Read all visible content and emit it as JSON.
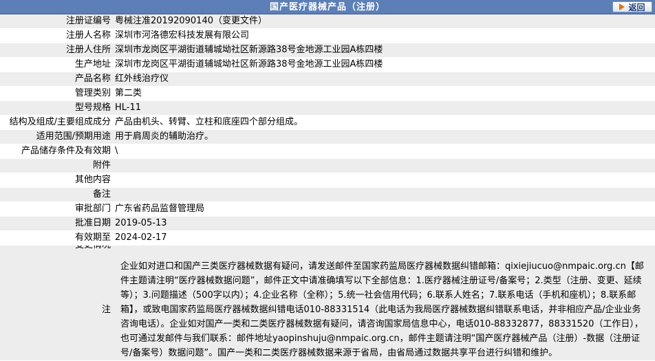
{
  "header": {
    "title": "国产医疗器械产品（注册）",
    "back_label": "返回",
    "colors": {
      "bar": "#5b7fb6",
      "row_alt": "#ededed"
    }
  },
  "fields": [
    {
      "label": "注册证编号",
      "value": "粤械注准20192090140（变更文件）"
    },
    {
      "label": "注册人名称",
      "value": "深圳市河洛德宏科技发展有限公司"
    },
    {
      "label": "注册人住所",
      "value": "深圳市龙岗区平湖街道辅城坳社区新源路38号金地源工业园A栋四楼"
    },
    {
      "label": "生产地址",
      "value": "深圳市龙岗区平湖街道辅城坳社区新源路38号金地源工业园A栋四楼"
    },
    {
      "label": "产品名称",
      "value": "红外线治疗仪"
    },
    {
      "label": "管理类别",
      "value": "第二类"
    },
    {
      "label": "型号规格",
      "value": "HL-11"
    },
    {
      "label": "结构及组成/主要组成成分",
      "value": "产品由机头、转臂、立柱和底座四个部分组成。"
    },
    {
      "label": "适用范围/预期用途",
      "value": "用于肩周炎的辅助治疗。"
    },
    {
      "label": "产品储存条件及有效期",
      "value": "\\"
    },
    {
      "label": "附件",
      "value": ""
    },
    {
      "label": "其他内容",
      "value": ""
    },
    {
      "label": "备注",
      "value": ""
    },
    {
      "label": "审批部门",
      "value": "广东省药品监督管理局"
    },
    {
      "label": "批准日期",
      "value": "2019-05-13"
    },
    {
      "label": "有效期至",
      "value": "2024-02-17"
    },
    {
      "label": "变更情况",
      "value": ""
    }
  ],
  "note": {
    "label": "注",
    "text": "企业如对进口和国产三类医疗器械数据有疑问，请发送邮件至国家药监局医疗器械数据纠错邮箱：qixiejiucuo@nmpaic.org.cn【邮件主题请注明“医疗器械数据问题”，邮件正文中请准确填写以下全部信息：1.医疗器械注册证号/备案号；2.类型（注册、变更、延续等）；3.问题描述（500字以内）；4.企业名称（全称）；5.统一社会信用代码；6.联系人姓名；7.联系电话（手机和座机）；8.联系邮箱】，或致电国家药监局医疗器械数据纠错电话010-88331514（此电话为我局医疗器械数据纠错联系电话，并非相应产品/企业业务咨询电话）。企业如对国产一类和二类医疗器械数据有疑问，请咨询国家局信息中心，电话010-88332877，88331520（工作日），也可通过发邮件与我们联系：邮件地址yaopinshuju@nmpaic.org.cn，邮件主题请注明“国产医疗器械产品（注册）-数据（注册证号/备案号）数据问题”。国产一类和二类医疗器械数据来源于省局，由省局通过数据共享平台进行纠错和维护。"
  }
}
